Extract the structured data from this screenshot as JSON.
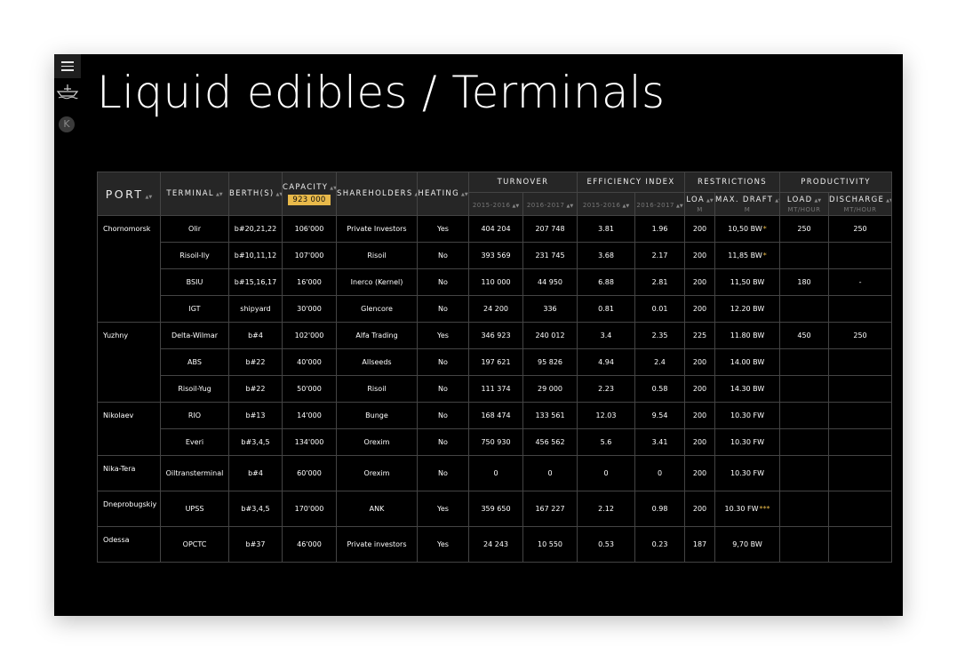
{
  "page": {
    "title": "Liquid edibles / Terminals"
  },
  "sidebar": {
    "menu_icon": "hamburger-menu-icon",
    "ship_icon": "ship-icon",
    "k_badge": "K"
  },
  "colors": {
    "accent": "#e8b94a",
    "background": "#000000",
    "header_bg": "#262626",
    "grid": "#444444"
  },
  "table": {
    "headers": {
      "port": "PORT",
      "terminal": "TERMINAL",
      "berths": "BERTH(S)",
      "capacity": "CAPACITY",
      "capacity_total": "923 000",
      "shareholders": "SHAREHOLDERS",
      "heating": "HEATING",
      "turnover": "TURNOVER",
      "turnover_y1": "2015-2016",
      "turnover_y2": "2016-2017",
      "efficiency": "EFFICIENCY INDEX",
      "efficiency_y1": "2015-2016",
      "efficiency_y2": "2016-2017",
      "restrictions": "RESTRICTIONS",
      "loa": "LOA",
      "loa_unit": "M",
      "draft": "MAX. DRAFT",
      "draft_unit": "M",
      "productivity": "PRODUCTIVITY",
      "load": "LOAD",
      "load_unit": "MT/HOUR",
      "discharge": "DISCHARGE",
      "discharge_unit": "MT/HOUR"
    },
    "ports": [
      {
        "port": "Chornomorsk",
        "rows": [
          {
            "terminal": "Olir",
            "berth": "b#20,21,22",
            "capacity": "106'000",
            "shareholders": "Private Investors",
            "heating": "Yes",
            "t1": "404 204",
            "t2": "207 748",
            "e1": "3.81",
            "e2": "1.96",
            "loa": "200",
            "draft": "10,50 BW",
            "mark": "*",
            "load": "250",
            "discharge": "250"
          },
          {
            "terminal": "Risoil-Ily",
            "berth": "b#10,11,12",
            "capacity": "107'000",
            "shareholders": "Risoil",
            "heating": "No",
            "t1": "393 569",
            "t2": "231 745",
            "e1": "3.68",
            "e2": "2.17",
            "loa": "200",
            "draft": "11,85 BW",
            "mark": "*",
            "load": "",
            "discharge": ""
          },
          {
            "terminal": "BSIU",
            "berth": "b#15,16,17",
            "capacity": "16'000",
            "shareholders": "Inerco (Kernel)",
            "heating": "No",
            "t1": "110 000",
            "t2": "44 950",
            "e1": "6.88",
            "e2": "2.81",
            "loa": "200",
            "draft": "11,50 BW",
            "mark": "",
            "load": "180",
            "discharge": "-"
          },
          {
            "terminal": "IGT",
            "berth": "shipyard",
            "capacity": "30'000",
            "shareholders": "Glencore",
            "heating": "No",
            "t1": "24 200",
            "t2": "336",
            "e1": "0.81",
            "e2": "0.01",
            "loa": "200",
            "draft": "12.20 BW",
            "mark": "",
            "load": "",
            "discharge": ""
          }
        ]
      },
      {
        "port": "Yuzhny",
        "rows": [
          {
            "terminal": "Delta-Wilmar",
            "berth": "b#4",
            "capacity": "102'000",
            "shareholders": "Alfa Trading",
            "heating": "Yes",
            "t1": "346 923",
            "t2": "240 012",
            "e1": "3.4",
            "e2": "2.35",
            "loa": "225",
            "draft": "11.80 BW",
            "mark": "",
            "load": "450",
            "discharge": "250"
          },
          {
            "terminal": "ABS",
            "berth": "b#22",
            "capacity": "40'000",
            "shareholders": "Allseeds",
            "heating": "No",
            "t1": "197 621",
            "t2": "95 826",
            "e1": "4.94",
            "e2": "2.4",
            "loa": "200",
            "draft": "14.00 BW",
            "mark": "",
            "load": "",
            "discharge": ""
          },
          {
            "terminal": "Risoil-Yug",
            "berth": "b#22",
            "capacity": "50'000",
            "shareholders": "Risoil",
            "heating": "No",
            "t1": "111 374",
            "t2": "29 000",
            "e1": "2.23",
            "e2": "0.58",
            "loa": "200",
            "draft": "14.30 BW",
            "mark": "",
            "load": "",
            "discharge": ""
          }
        ]
      },
      {
        "port": "Nikolaev",
        "rows": [
          {
            "terminal": "RIO",
            "berth": "b#13",
            "capacity": "14'000",
            "shareholders": "Bunge",
            "heating": "No",
            "t1": "168 474",
            "t2": "133 561",
            "e1": "12.03",
            "e2": "9.54",
            "loa": "200",
            "draft": "10.30 FW",
            "mark": "",
            "load": "",
            "discharge": ""
          },
          {
            "terminal": "Everi",
            "berth": "b#3,4,5",
            "capacity": "134'000",
            "shareholders": "Orexim",
            "heating": "No",
            "t1": "750 930",
            "t2": "456 562",
            "e1": "5.6",
            "e2": "3.41",
            "loa": "200",
            "draft": "10.30 FW",
            "mark": "",
            "load": "",
            "discharge": ""
          }
        ]
      },
      {
        "port": "Nika-Tera",
        "rows": [
          {
            "terminal": "Oiltransterminal",
            "berth": "b#4",
            "capacity": "60'000",
            "shareholders": "Orexim",
            "heating": "No",
            "t1": "0",
            "t2": "0",
            "e1": "0",
            "e2": "0",
            "loa": "200",
            "draft": "10.30 FW",
            "mark": "",
            "load": "",
            "discharge": ""
          }
        ]
      },
      {
        "port": "Dneprobugskiy",
        "rows": [
          {
            "terminal": "UPSS",
            "berth": "b#3,4,5",
            "capacity": "170'000",
            "shareholders": "ANK",
            "heating": "Yes",
            "t1": "359 650",
            "t2": "167 227",
            "e1": "2.12",
            "e2": "0.98",
            "loa": "200",
            "draft": "10.30 FW",
            "mark": "***",
            "load": "",
            "discharge": ""
          }
        ]
      },
      {
        "port": "Odessa",
        "rows": [
          {
            "terminal": "OPCTC",
            "berth": "b#37",
            "capacity": "46'000",
            "shareholders": "Private investors",
            "heating": "Yes",
            "t1": "24 243",
            "t2": "10 550",
            "e1": "0.53",
            "e2": "0.23",
            "loa": "187",
            "draft": "9,70 BW",
            "mark": "",
            "load": "",
            "discharge": ""
          }
        ]
      }
    ]
  }
}
